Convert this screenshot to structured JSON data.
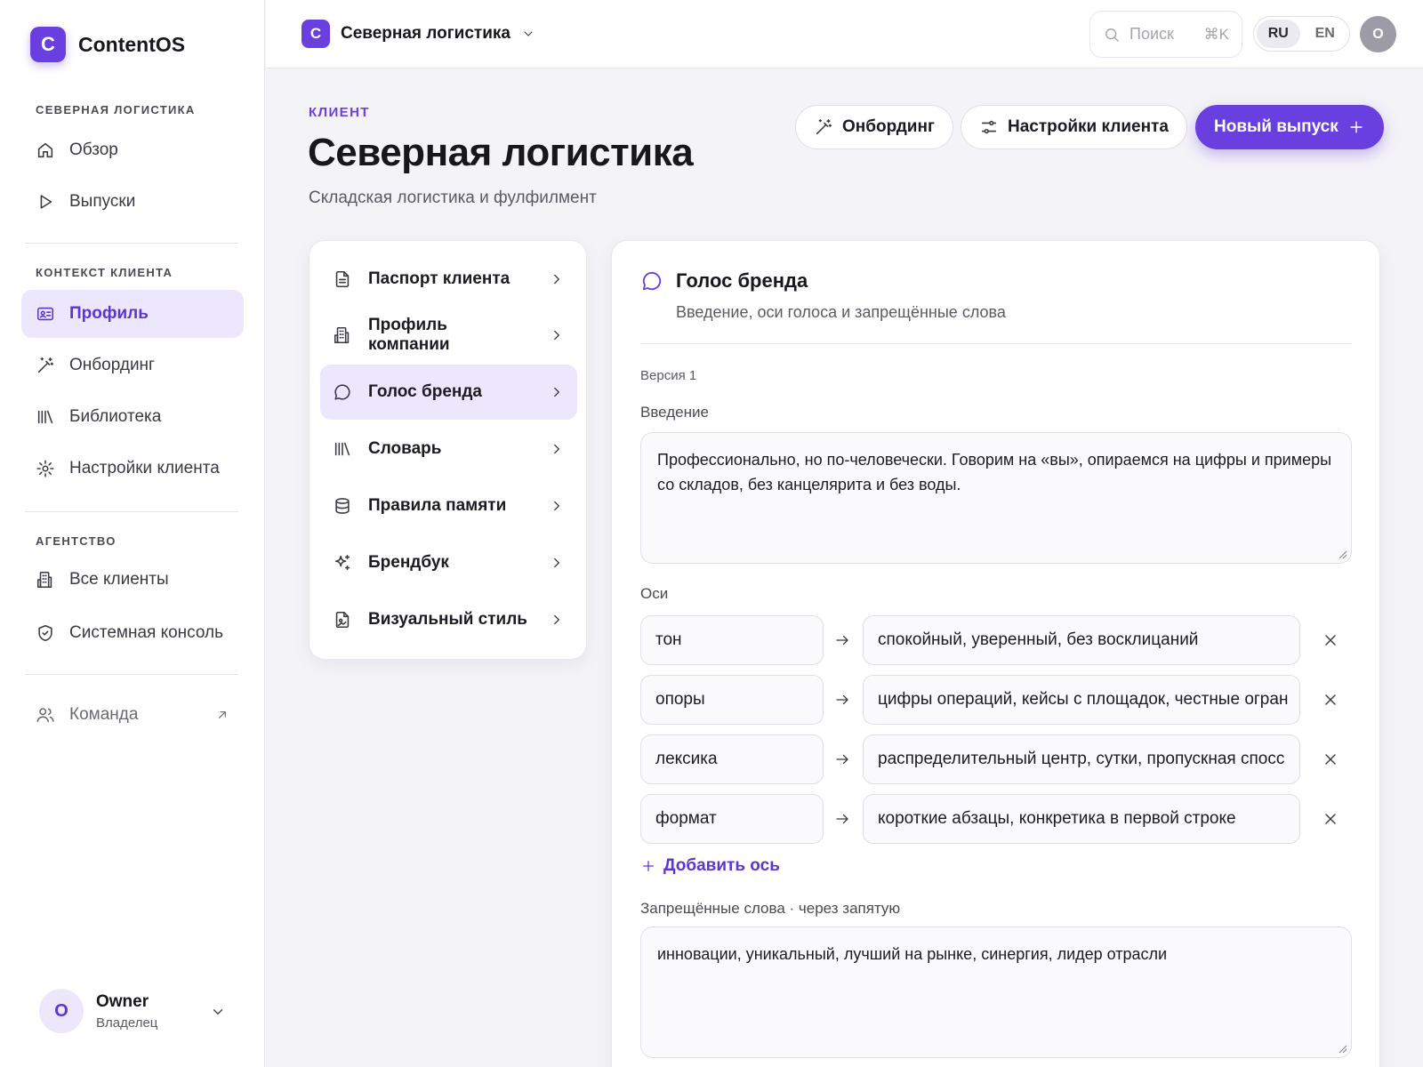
{
  "app": {
    "logo_letter": "C",
    "name": "ContentOS"
  },
  "sidebar": {
    "sections": [
      {
        "label": "СЕВЕРНАЯ ЛОГИСТИКА"
      },
      {
        "label": "КОНТЕКСТ КЛИЕНТА"
      },
      {
        "label": "АГЕНТСТВО"
      }
    ],
    "items": [
      {
        "label": "Обзор",
        "icon": "home-icon"
      },
      {
        "label": "Выпуски",
        "icon": "play-icon"
      },
      {
        "label": "Профиль",
        "icon": "id-card-icon",
        "active": true
      },
      {
        "label": "Онбординг",
        "icon": "magic-wand-icon"
      },
      {
        "label": "Библиотека",
        "icon": "library-icon"
      },
      {
        "label": "Настройки клиента",
        "icon": "gear-icon"
      },
      {
        "label": "Все клиенты",
        "icon": "building-icon"
      },
      {
        "label": "Системная консоль",
        "icon": "shield-icon"
      },
      {
        "label": "Команда",
        "icon": "users-icon",
        "external": true
      }
    ],
    "user": {
      "initial": "O",
      "name": "Owner",
      "role": "Владелец"
    }
  },
  "topbar": {
    "client": {
      "logo_letter": "C",
      "name": "Северная логистика"
    },
    "search": {
      "placeholder": "Поиск",
      "shortcut": "⌘K"
    },
    "languages": [
      {
        "code": "RU",
        "active": true
      },
      {
        "code": "EN",
        "active": false
      }
    ],
    "avatar_initial": "O"
  },
  "header": {
    "eyebrow": "КЛИЕНТ",
    "title": "Северная логистика",
    "subtitle": "Складская логистика и фулфилмент",
    "actions": {
      "onboarding": "Онбординг",
      "settings": "Настройки клиента",
      "new_release": "Новый выпуск"
    }
  },
  "menu": {
    "items": [
      {
        "label": "Паспорт клиента",
        "icon": "document-icon"
      },
      {
        "label": "Профиль компании",
        "icon": "building-icon"
      },
      {
        "label": "Голос бренда",
        "icon": "chat-bubble-icon",
        "active": true
      },
      {
        "label": "Словарь",
        "icon": "library-icon"
      },
      {
        "label": "Правила памяти",
        "icon": "database-icon"
      },
      {
        "label": "Брендбук",
        "icon": "sparkles-icon"
      },
      {
        "label": "Визуальный стиль",
        "icon": "image-file-icon"
      }
    ]
  },
  "brand_voice": {
    "title": "Голос бренда",
    "description": "Введение, оси голоса и запрещённые слова",
    "version": "Версия 1",
    "intro_label": "Введение",
    "intro_text": "Профессионально, но по-человечески. Говорим на «вы», опираемся на цифры и примеры со складов, без канцелярита и без воды.",
    "axes_label": "Оси",
    "axes": [
      {
        "key": "тон",
        "value": "спокойный, уверенный, без восклицаний"
      },
      {
        "key": "опоры",
        "value": "цифры операций, кейсы с площадок, честные огран"
      },
      {
        "key": "лексика",
        "value": "распределительный центр, сутки, пропускная спосс"
      },
      {
        "key": "формат",
        "value": "короткие абзацы, конкретика в первой строке"
      }
    ],
    "add_axis": "Добавить ось",
    "forbidden_label": "Запрещённые слова · через запятую",
    "forbidden_text": "инновации, уникальный, лучший на рынке, синергия, лидер отрасли"
  },
  "colors": {
    "accent": "#6a3fe0",
    "accent_soft": "#ece7fd",
    "background": "#f4f3f7"
  }
}
